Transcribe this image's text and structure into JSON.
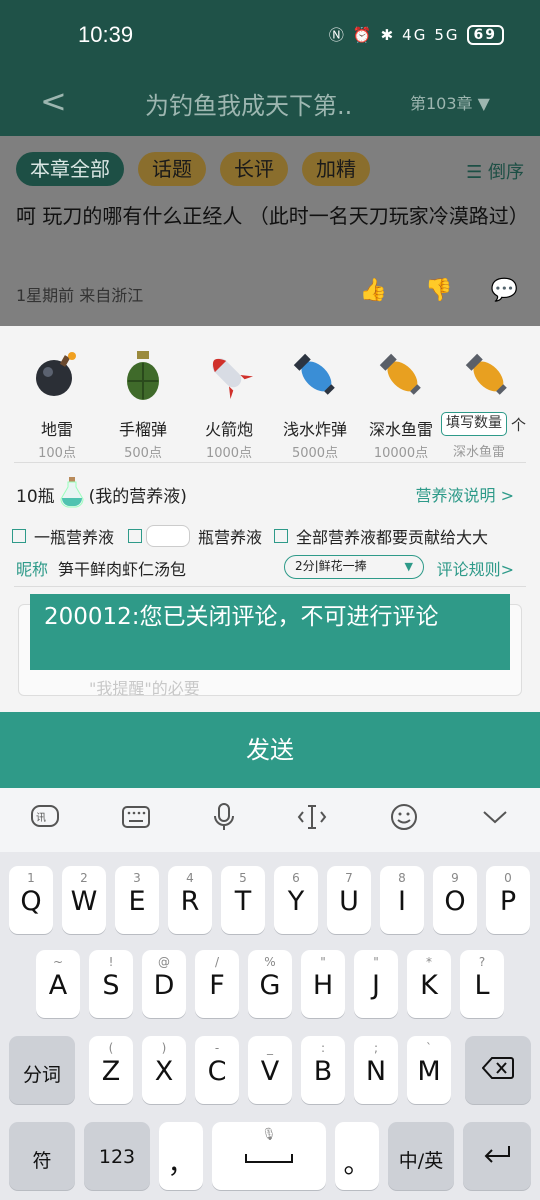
{
  "status": {
    "time": "10:39",
    "battery": "69",
    "net1": "4G",
    "net2": "5G"
  },
  "header": {
    "back": "<",
    "title": "为钓鱼我成天下第..",
    "chapter": "第103章 ▼"
  },
  "tabs": [
    "本章全部",
    "话题",
    "长评",
    "加精"
  ],
  "order_label": "倒序",
  "comment": {
    "text": "呵 玩刀的哪有什么正经人 （此时一名天刀玩家冷漠路过）",
    "meta": "1星期前  来自浙江"
  },
  "gifts": [
    {
      "name": "地雷",
      "points": "100点",
      "icon": "bomb-icon"
    },
    {
      "name": "手榴弹",
      "points": "500点",
      "icon": "grenade-icon"
    },
    {
      "name": "火箭炮",
      "points": "1000点",
      "icon": "rocket-icon"
    },
    {
      "name": "浅水炸弹",
      "points": "5000点",
      "icon": "shallow-bomb-icon"
    },
    {
      "name": "深水鱼雷",
      "points": "10000点",
      "icon": "torpedo-icon"
    }
  ],
  "quantity": {
    "placeholder": "填写数量",
    "unit": "个",
    "name": "深水鱼雷"
  },
  "nutrient": {
    "count": "10瓶",
    "mine": "(我的营养液)",
    "link": "营养液说明 >"
  },
  "checks": {
    "one": "一瓶营养液",
    "custom": "瓶营养液",
    "all": "全部营养液都要贡献给大大"
  },
  "nick": {
    "label": "昵称",
    "value": "笋干鲜肉虾仁汤包"
  },
  "select": {
    "value": "2分|鲜花一捧"
  },
  "rules_link": "评论规则>",
  "textarea": {
    "placeholder": "\"我提醒\"的必要"
  },
  "toast": "200012:您已关闭评论，不可进行评论",
  "send_label": "发送",
  "keyboard": {
    "row1": [
      [
        "1",
        "Q"
      ],
      [
        "2",
        "W"
      ],
      [
        "3",
        "E"
      ],
      [
        "4",
        "R"
      ],
      [
        "5",
        "T"
      ],
      [
        "6",
        "Y"
      ],
      [
        "7",
        "U"
      ],
      [
        "8",
        "I"
      ],
      [
        "9",
        "O"
      ],
      [
        "0",
        "P"
      ]
    ],
    "row2": [
      [
        "~",
        "A"
      ],
      [
        "!",
        "S"
      ],
      [
        "@",
        "D"
      ],
      [
        "/",
        "F"
      ],
      [
        "%",
        "G"
      ],
      [
        "\"",
        "H"
      ],
      [
        "\"",
        "J"
      ],
      [
        "*",
        "K"
      ],
      [
        "?",
        "L"
      ]
    ],
    "row3": [
      [
        "(",
        "Z"
      ],
      [
        ")",
        "X"
      ],
      [
        "-",
        "C"
      ],
      [
        "_",
        "V"
      ],
      [
        ":",
        "B"
      ],
      [
        ";",
        "N"
      ],
      [
        "`",
        "M"
      ]
    ],
    "fenci": "分词",
    "fu": "符",
    "num": "123",
    "comma": "，",
    "period": "。",
    "lang": "中/英"
  }
}
